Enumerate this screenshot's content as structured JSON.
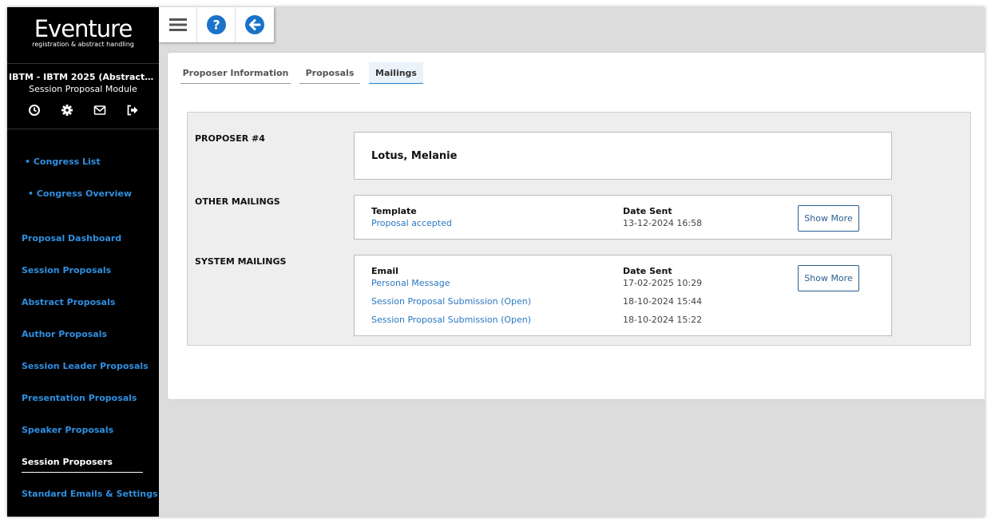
{
  "brand": {
    "title": "Eventure",
    "subtitle": "registration & abstract handling"
  },
  "congress": {
    "name": "IBTM - IBTM 2025 (Abstracts & Par...",
    "module": "Session Proposal Module"
  },
  "sidebar_icons": [
    "clock-icon",
    "gear-icon",
    "mail-icon",
    "logout-icon"
  ],
  "nav": {
    "sub_items": [
      "• Congress List",
      "• Congress Overview"
    ],
    "items": [
      "Proposal Dashboard",
      "Session Proposals",
      "Abstract Proposals",
      "Author Proposals",
      "Session Leader Proposals",
      "Presentation Proposals",
      "Speaker Proposals",
      "Session Proposers",
      "Standard Emails & Settings"
    ],
    "active": "Session Proposers"
  },
  "toolbar": [
    "menu-icon",
    "help-icon",
    "back-icon"
  ],
  "tabs": [
    "Proposer Information",
    "Proposals",
    "Mailings"
  ],
  "active_tab": "Mailings",
  "proposer": {
    "label": "PROPOSER #4",
    "name": "Lotus, Melanie"
  },
  "other_mailings": {
    "label": "OTHER MAILINGS",
    "col1_header": "Template",
    "col2_header": "Date Sent",
    "rows": [
      {
        "name": "Proposal accepted",
        "date": "13-12-2024 16:58"
      }
    ],
    "button": "Show More"
  },
  "system_mailings": {
    "label": "SYSTEM MAILINGS",
    "col1_header": "Email",
    "col2_header": "Date Sent",
    "rows": [
      {
        "name": "Personal Message",
        "date": "17-02-2025 10:29"
      },
      {
        "name": "Session Proposal Submission (Open)",
        "date": "18-10-2024 15:44"
      },
      {
        "name": "Session Proposal Submission (Open)",
        "date": "18-10-2024 15:22"
      }
    ],
    "button": "Show More"
  },
  "colors": {
    "sidebar_bg": "#000000",
    "link": "#2b78c2",
    "nav_link": "#2f8fe0",
    "icon_blue": "#1a73c9"
  }
}
